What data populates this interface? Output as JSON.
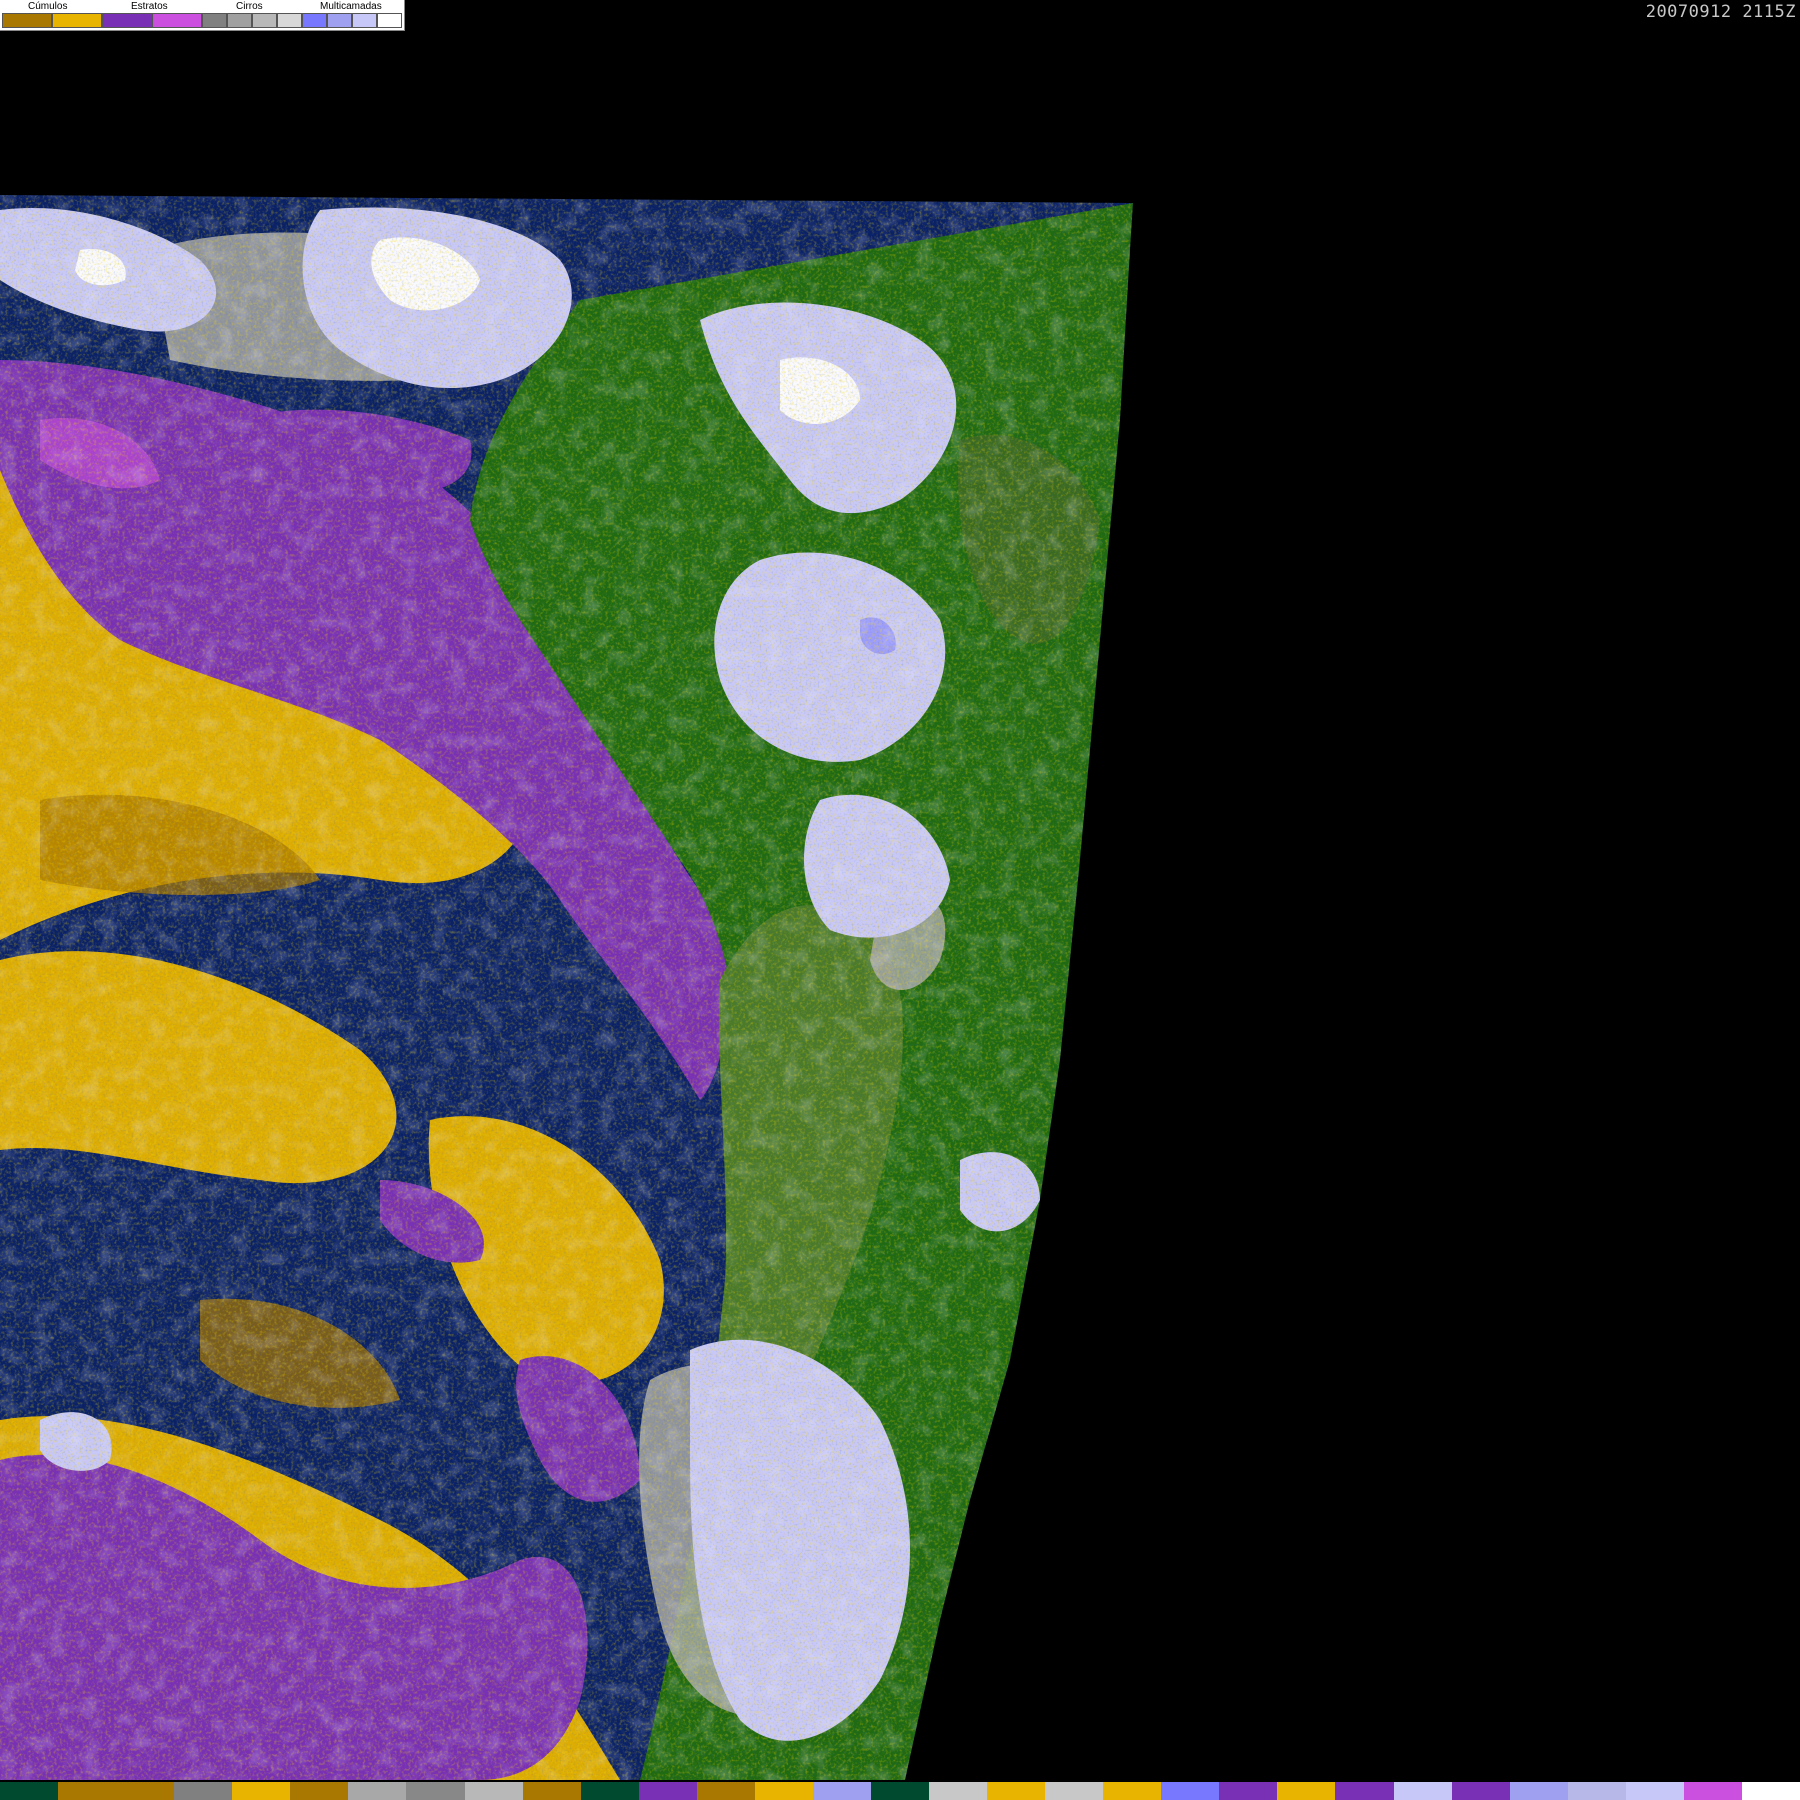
{
  "timestamp": "20070912 2115Z",
  "legend": {
    "groups": [
      {
        "label": "Cúmulos",
        "colors": [
          "#a87800",
          "#e8b400"
        ]
      },
      {
        "label": "Estratos",
        "colors": [
          "#7a30b4",
          "#cc50e0"
        ]
      },
      {
        "label": "Cirros",
        "colors": [
          "#808080",
          "#a0a0a0",
          "#b8b8b8",
          "#d8d8d8"
        ]
      },
      {
        "label": "Multicamadas",
        "colors": [
          "#7878ff",
          "#a0a0f0",
          "#c8c8f8",
          "#ffffff"
        ]
      }
    ]
  },
  "palette": {
    "ocean": "#0a2166",
    "land": "#1f6a12",
    "land_dry": "#4a7a2a",
    "cumulus": "#e8b400",
    "cumulus_dark": "#a87800",
    "stratus": "#7a30b4",
    "stratus_light": "#cc50e0",
    "cirrus": "#a8a8a8",
    "multilayer": "#c8c8f8",
    "offdisk": "#000000"
  },
  "bottom_strip": [
    "#004a30",
    "#a87800",
    "#a87800",
    "#808080",
    "#e8b400",
    "#a87800",
    "#a8a8a8",
    "#888888",
    "#b8b8b8",
    "#a87800",
    "#004a30",
    "#7a30b4",
    "#a87800",
    "#e8b400",
    "#a0a0f0",
    "#004a30",
    "#c8c8c8",
    "#e8b400",
    "#c8c8c8",
    "#e8b400",
    "#7878ff",
    "#7a30b4",
    "#e8b400",
    "#7a30b4",
    "#c8c8f8",
    "#7a30b4",
    "#a0a0f0",
    "#b8b8e8",
    "#c8c8f8",
    "#cc50e0",
    "#ffffff"
  ]
}
